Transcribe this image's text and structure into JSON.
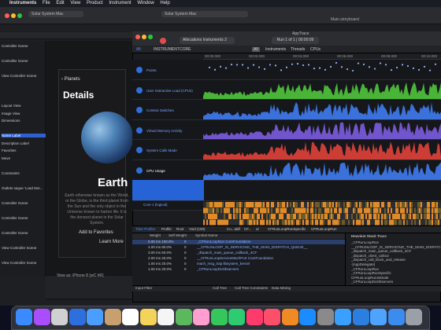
{
  "menubar": {
    "items": [
      "Instruments",
      "File",
      "Edit",
      "View",
      "Product",
      "Instrument",
      "Window",
      "Help"
    ]
  },
  "xcode": {
    "scheme": "Solar System Mac",
    "scheme2": "Solar System Mac",
    "status": "Main.storyboard",
    "nav": [
      "Controller Scene",
      "",
      "Controller Scene",
      "",
      "View Controller Scene",
      "",
      "",
      "",
      "Layout View",
      "Image View",
      "Dimensions",
      "",
      "Name Label",
      "Description Label",
      "Favorites",
      "Move",
      "",
      "Constraints",
      "",
      "Outlets segue 'Load Mor...",
      "",
      "Controller Scene",
      "",
      "Controller Scene",
      "",
      "Controller Scene",
      "",
      "View Controller Scene",
      "",
      "View Controller Scene"
    ],
    "phone": {
      "back": "Planets",
      "title": "Details",
      "name": "Earth",
      "desc": "Earth otherwise known as the World, or the Globe, is the third planet from the Sun and the only object in the Universe known to harbor life. It is the densest planet in the Solar System.",
      "fav": "Add to Favorites",
      "learn": "Learn More"
    },
    "viewas": "View as: iPhone 8 (wC hR)"
  },
  "instruments": {
    "title": "AppTrace",
    "target": "Allocations Instruments 2",
    "run": "Run 1 of 1 | 00:00:09",
    "filter_tabs": [
      "INSTRUMENT",
      "CORE",
      "All",
      "Instruments",
      "Threads",
      "CPUs"
    ],
    "ruler": [
      "00:00.000",
      "00:02.000",
      "00:04.000",
      "00:06.000",
      "00:08.000",
      "00:10.000"
    ],
    "tracks": [
      {
        "label": "Points"
      },
      {
        "label": "User Interactive Load (CPUs)"
      },
      {
        "label": "Context Switches"
      },
      {
        "label": "Virtual Memory Activity"
      },
      {
        "label": "System Calls Made"
      },
      {
        "label": "CPU Usage"
      },
      {
        "label": "Core 0"
      },
      {
        "label": "Core 1 (logical)"
      }
    ],
    "bottom_tabs": [
      "Time Profiler",
      "Profile",
      "Root",
      "Void (100)",
      "Cu...aldf",
      "CF...",
      "ul",
      "CFRunLoopRunSpecific",
      "CFRunLoopRun"
    ],
    "calltree_header": [
      "Weight",
      "Self Weight",
      "Symbol Name"
    ],
    "rows": [
      {
        "w": "5.00 ms 100.0%",
        "s": "0",
        "n": "_CFRunLoopRun  CoreFoundation"
      },
      {
        "w": "4.00 ms  80.0%",
        "s": "0",
        "n": "__CFRUNLOOP_IS_SERVICING_THE_MAIN_DISPATCH_QUEUE__"
      },
      {
        "w": "3.00 ms  60.0%",
        "s": "0",
        "n": "_dispatch_main_queue_callback_4CF"
      },
      {
        "w": "2.00 ms  40.0%",
        "s": "0",
        "n": "__CFRunLoopServiceMachPort  CoreFoundation"
      },
      {
        "w": "1.00 ms  20.0%",
        "s": "0",
        "n": "mach_msg_trap  libsystem_kernel"
      },
      {
        "w": "1.00 ms  20.0%",
        "s": "0",
        "n": "_CFRunLoopDoObservers"
      }
    ],
    "stack_title": "Heaviest Stack Trace",
    "stack": [
      "_CFRunLoopRun",
      "__CFRUNLOOP_IS_SERVICING_THE_MAIN_DISPATCH_QUEUE__",
      "_dispatch_main_queue_callback_4CF",
      "_dispatch_client_callout",
      "_dispatch_call_block_and_release",
      "-[AppDelegate]",
      "_CFRunLoopRun",
      "_CFRunLoopRunSpecific",
      "CFRunLoopRunInMode",
      "_CFRunLoopDoObservers"
    ],
    "inbottom": [
      "Input Filter",
      "Call Tree",
      "Call Tree Constraints",
      "Data Mining"
    ]
  },
  "colors": {
    "accent": "#2563d6",
    "green": "#4fc53b",
    "blue": "#3e7bf0",
    "purple": "#7a5ce0",
    "red": "#e0413a",
    "orange": "#e08a2a"
  },
  "dock_icons": [
    "finder-icon",
    "siri-icon",
    "launchpad-icon",
    "safari-icon",
    "mail-icon",
    "contacts-icon",
    "calendar-icon",
    "notes-icon",
    "reminders-icon",
    "maps-icon",
    "photos-icon",
    "messages-icon",
    "facetime-icon",
    "itunes-icon",
    "music-icon",
    "books-icon",
    "appstore-icon",
    "preferences-icon",
    "xcode-icon",
    "instruments-icon",
    "finder-folder-icon",
    "downloads-icon",
    "trash-icon"
  ]
}
